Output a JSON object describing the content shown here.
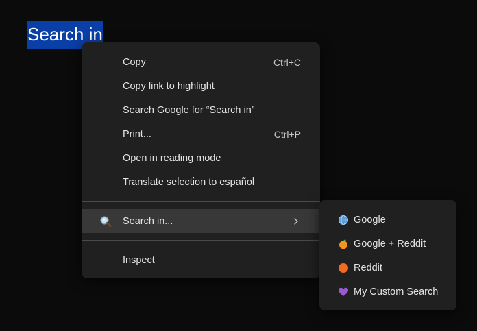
{
  "selection": {
    "text": "Search in"
  },
  "context_menu": {
    "items": [
      {
        "label": "Copy",
        "shortcut": "Ctrl+C"
      },
      {
        "label": "Copy link to highlight",
        "shortcut": ""
      },
      {
        "label": "Search Google for “Search in”",
        "shortcut": ""
      },
      {
        "label": "Print...",
        "shortcut": "Ctrl+P"
      },
      {
        "label": "Open in reading mode",
        "shortcut": ""
      },
      {
        "label": "Translate selection to español",
        "shortcut": ""
      }
    ],
    "search_in": {
      "label": "Search in...",
      "icon": "magnifier-icon"
    },
    "inspect": {
      "label": "Inspect"
    }
  },
  "submenu": {
    "items": [
      {
        "label": "Google",
        "icon": "globe-icon"
      },
      {
        "label": "Google + Reddit",
        "icon": "tangerine-icon"
      },
      {
        "label": "Reddit",
        "icon": "orange-circle-icon"
      },
      {
        "label": "My Custom Search",
        "icon": "purple-heart-icon"
      }
    ]
  },
  "colors": {
    "background": "#0b0b0b",
    "menu_bg": "#202020",
    "highlight_bg": "#383838",
    "selection_bg": "#0a3fa8",
    "text": "#e3e3e3"
  }
}
